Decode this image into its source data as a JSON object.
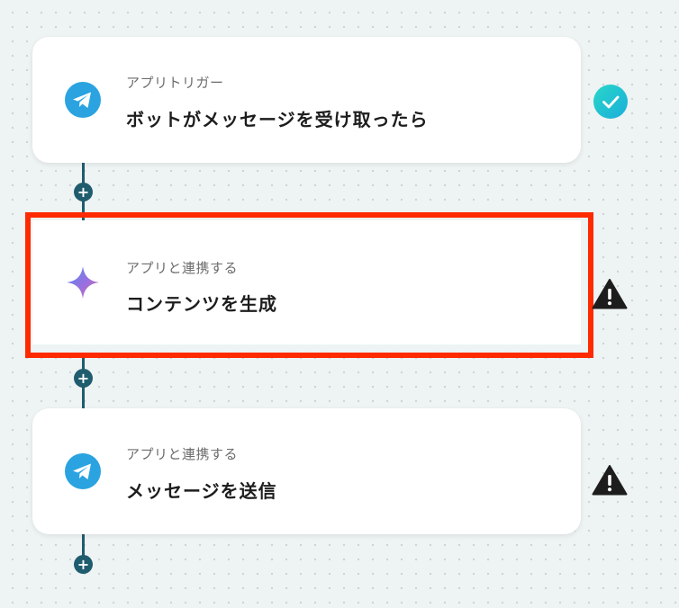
{
  "steps": [
    {
      "subtitle": "アプリトリガー",
      "title": "ボットがメッセージを受け取ったら",
      "app_icon": "telegram-icon",
      "status": "success-check-icon"
    },
    {
      "subtitle": "アプリと連携する",
      "title": "コンテンツを生成",
      "app_icon": "gemini-sparkle-icon",
      "status": "warning-icon"
    },
    {
      "subtitle": "アプリと連携する",
      "title": "メッセージを送信",
      "app_icon": "telegram-icon",
      "status": "warning-icon"
    }
  ],
  "add_step_symbol": "+",
  "colors": {
    "connector": "#1f5d6e",
    "highlight": "#ff2a00",
    "success": "#1fc4d0",
    "warning": "#1d1d1d",
    "telegram": "#2aa3e0"
  }
}
